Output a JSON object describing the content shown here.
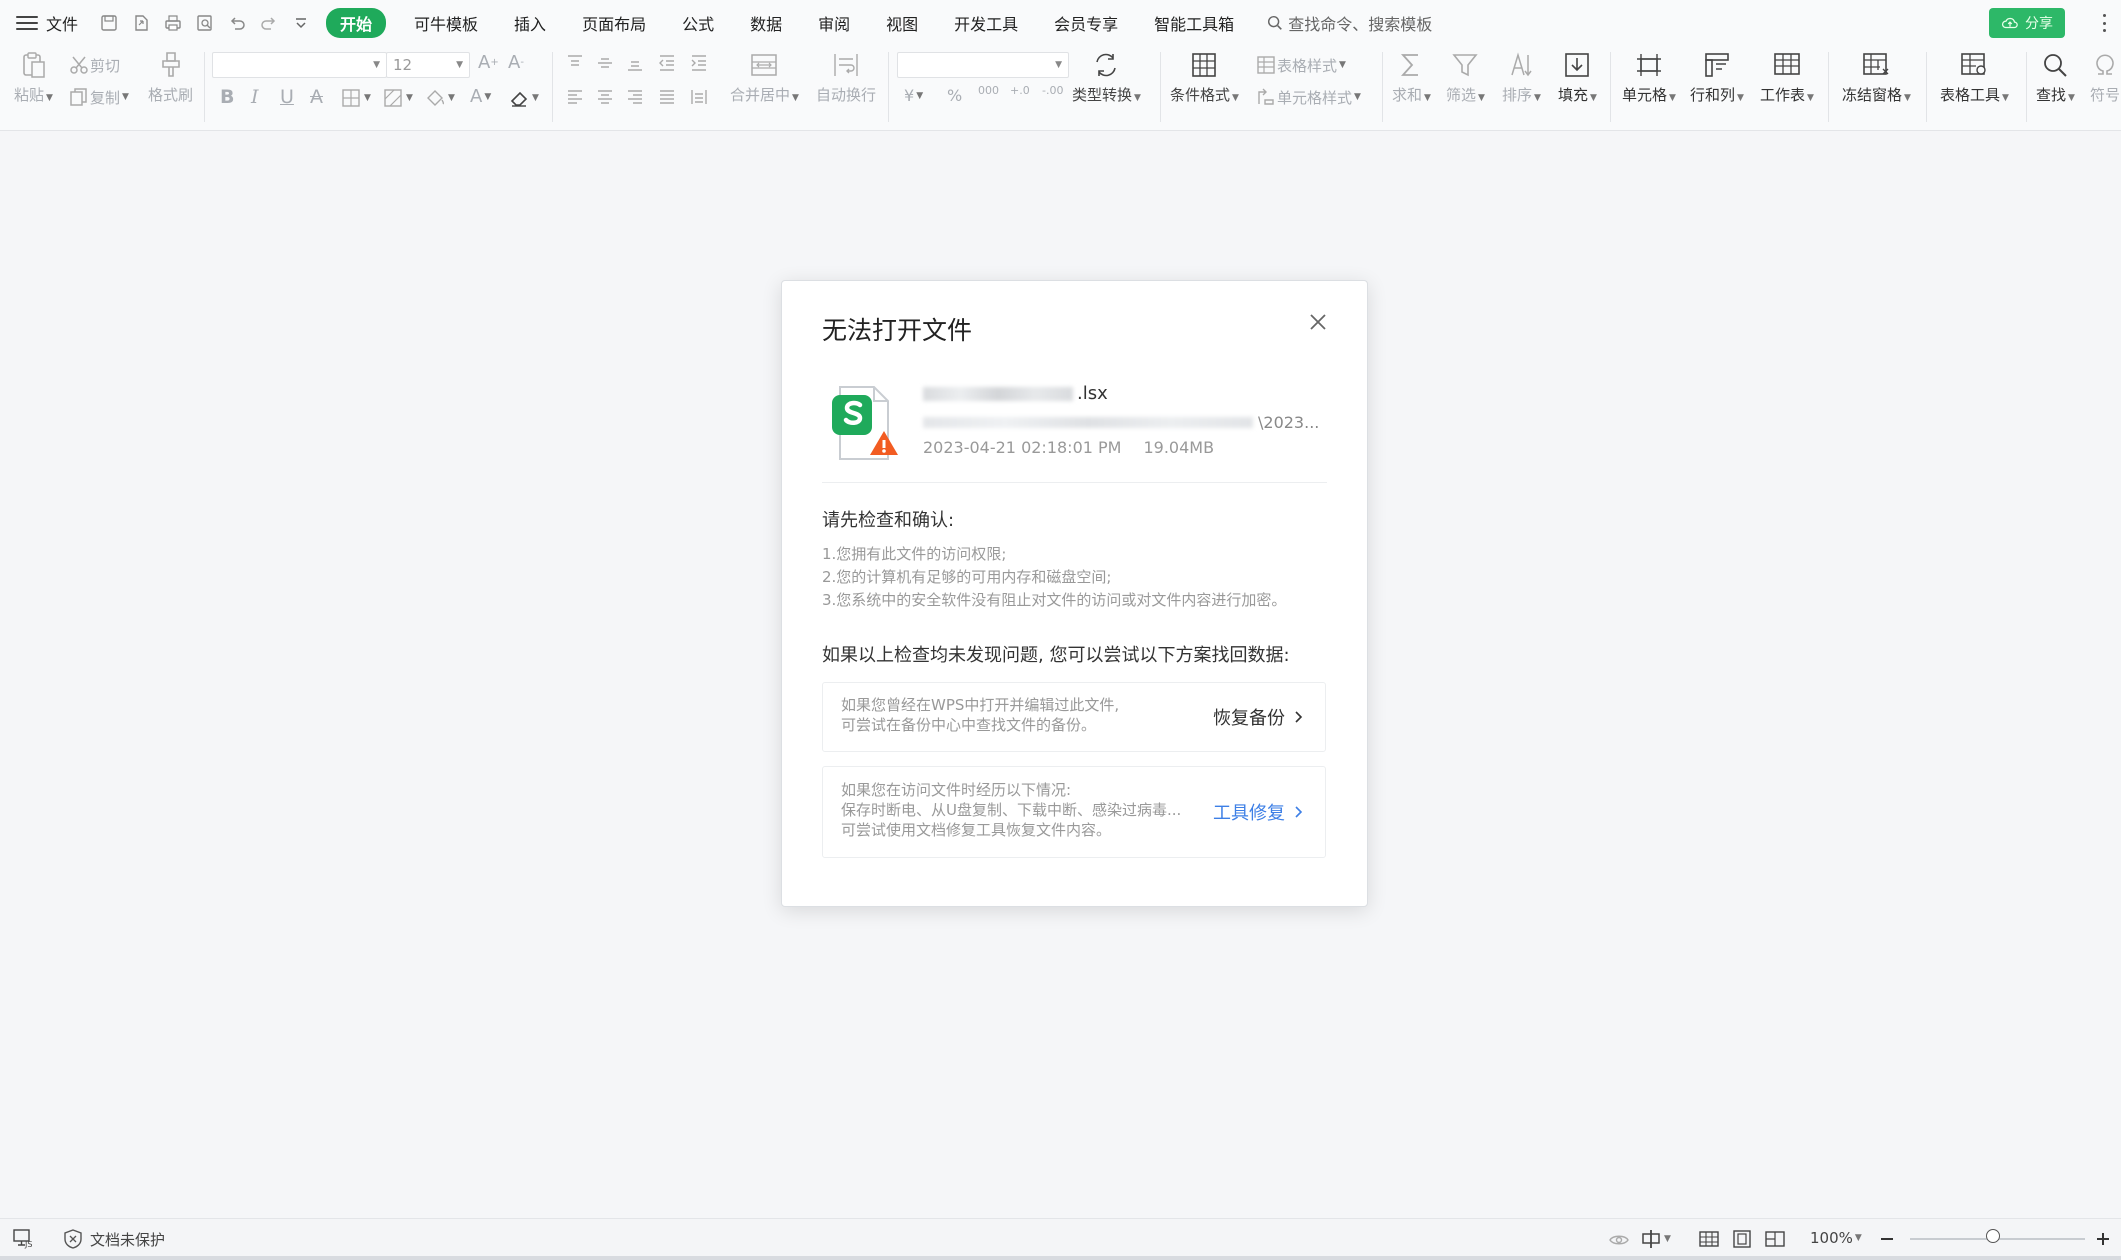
{
  "menubar": {
    "file_label": "文件",
    "tabs": [
      "开始",
      "可牛模板",
      "插入",
      "页面布局",
      "公式",
      "数据",
      "审阅",
      "视图",
      "开发工具",
      "会员专享",
      "智能工具箱"
    ],
    "search_label": "查找命令、搜索模板",
    "share_label": "分享"
  },
  "ribbon": {
    "paste": "粘贴",
    "cut": "剪切",
    "copy": "复制",
    "format_painter": "格式刷",
    "font_size": "12",
    "merge_center": "合并居中",
    "wrap_text": "自动换行",
    "type_convert": "类型转换",
    "conditional_format": "条件格式",
    "table_style": "表格样式",
    "cell_style": "单元格样式",
    "sum": "求和",
    "filter": "筛选",
    "sort": "排序",
    "fill": "填充",
    "cell": "单元格",
    "row_col": "行和列",
    "worksheet": "工作表",
    "freeze": "冻结窗格",
    "table_tools": "表格工具",
    "find": "查找",
    "symbol": "符号",
    "currency_symbol": "¥",
    "percent_symbol": "%",
    "thousands_symbol": "000",
    "decimal_increase": "+.0",
    "decimal_decrease": "-.00"
  },
  "dialog": {
    "title": "无法打开文件",
    "file_ext": ".lsx",
    "file_path_tail": "\\2023...",
    "file_date": "2023-04-21  02:18:01 PM",
    "file_size": "19.04MB",
    "check_heading": "请先检查和确认:",
    "check_items": [
      "1.您拥有此文件的访问权限;",
      "2.您的计算机有足够的可用内存和磁盘空间;",
      "3.您系统中的安全软件没有阻止对文件的访问或对文件内容进行加密。"
    ],
    "recover_heading": "如果以上检查均未发现问题, 您可以尝试以下方案找回数据:",
    "backup_card": {
      "lines": [
        "如果您曾经在WPS中打开并编辑过此文件,",
        "可尝试在备份中心中查找文件的备份。"
      ],
      "action": "恢复备份"
    },
    "repair_card": {
      "lines": [
        "如果您在访问文件时经历以下情况:",
        "保存时断电、从U盘复制、下载中断、感染过病毒...",
        "可尝试使用文档修复工具恢复文件内容。"
      ],
      "action": "工具修复"
    }
  },
  "statusbar": {
    "protect_label": "文档未保护",
    "zoom_label": "100%"
  },
  "colors": {
    "accent_green": "#1faa5b",
    "link_blue": "#3d7fe6",
    "warning_orange": "#f25c22"
  }
}
